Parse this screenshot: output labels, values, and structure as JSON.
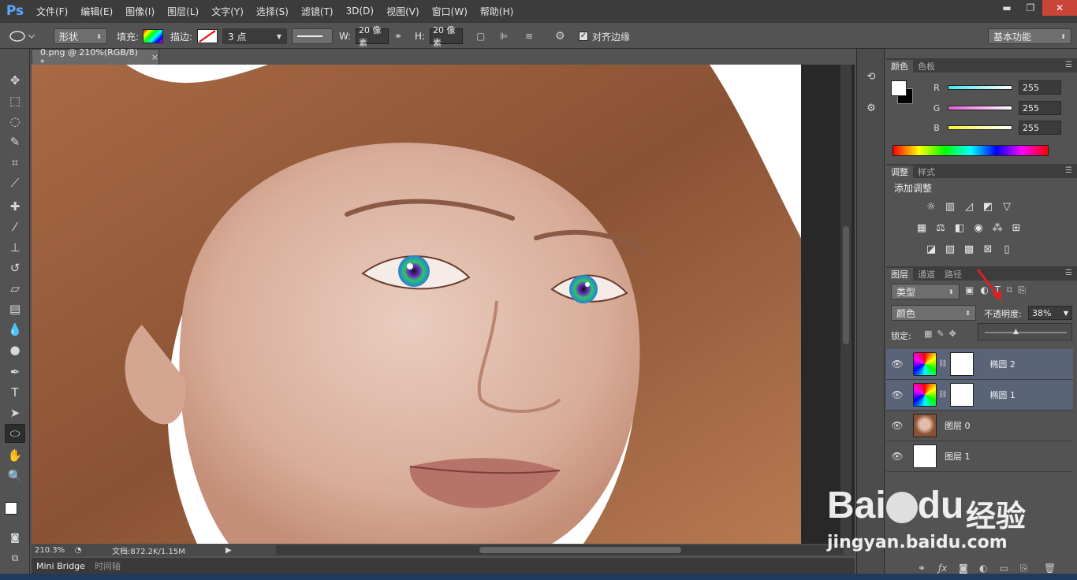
{
  "app": {
    "logo": "Ps"
  },
  "menu": [
    "文件(F)",
    "编辑(E)",
    "图像(I)",
    "图层(L)",
    "文字(Y)",
    "选择(S)",
    "滤镜(T)",
    "3D(D)",
    "视图(V)",
    "窗口(W)",
    "帮助(H)"
  ],
  "window_controls": {
    "minimize": "▬",
    "restore": "❐",
    "close": "✕"
  },
  "options": {
    "mode": "形状",
    "fill_label": "填充:",
    "stroke_label": "描边:",
    "stroke_size": "3 点",
    "w_label": "W:",
    "w_value": "20 像素",
    "h_label": "H:",
    "h_value": "20 像素",
    "align_label": "对齐边缘",
    "workspace": "基本功能"
  },
  "document": {
    "tab": "0.png @ 210%(RGB/8) *",
    "close": "×"
  },
  "status": {
    "zoom": "210.3%",
    "doc": "文档:872.2K/1.15M"
  },
  "bottom_tabs": [
    "Mini Bridge",
    "时间轴"
  ],
  "color_panel": {
    "tabs": [
      "颜色",
      "色板"
    ],
    "channels": [
      {
        "label": "R",
        "value": "255",
        "color": "#3fe8f0"
      },
      {
        "label": "G",
        "value": "255",
        "color": "#e65ad8"
      },
      {
        "label": "B",
        "value": "255",
        "color": "#f2f23a"
      }
    ]
  },
  "adjust_panel": {
    "tabs": [
      "调整",
      "样式"
    ],
    "title": "添加调整",
    "icons": [
      "brightness-icon",
      "levels-icon",
      "curves-icon",
      "exposure-icon",
      "vibrance-icon",
      "hsl-icon",
      "color-balance-icon",
      "bw-icon",
      "photo-filter-icon",
      "channel-mixer-icon",
      "color-lookup-icon",
      "invert-icon",
      "posterize-icon",
      "threshold-icon",
      "gradient-map-icon",
      "selective-color-icon"
    ]
  },
  "layers_panel": {
    "tabs": [
      "图层",
      "通道",
      "路径"
    ],
    "filter_kind": "类型",
    "blend_mode": "颜色",
    "opacity_label": "不透明度:",
    "opacity_value": "38%",
    "lock_label": "锁定:",
    "layers": [
      {
        "name": "椭圆 2",
        "selected": true
      },
      {
        "name": "椭圆 1",
        "selected": true
      },
      {
        "name": "图层 0",
        "selected": false
      },
      {
        "name": "图层 1",
        "selected": false
      }
    ]
  },
  "watermark": {
    "brand": "Bai",
    "brand2": "du",
    "cn": "经验",
    "url": "jingyan.baidu.com"
  }
}
